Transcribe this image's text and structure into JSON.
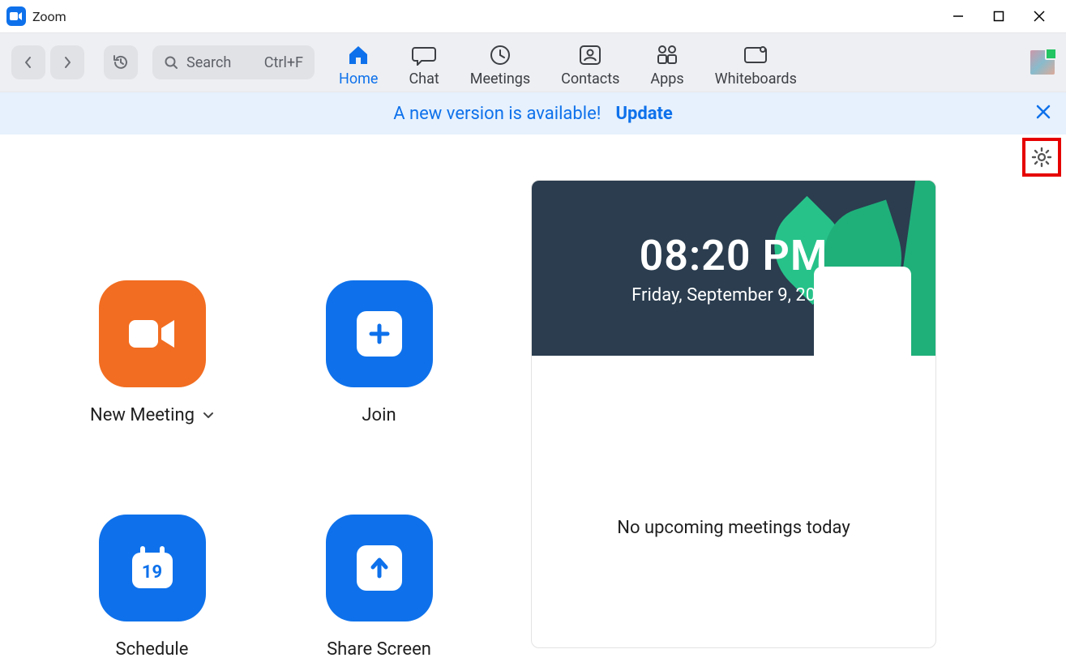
{
  "window": {
    "title": "Zoom"
  },
  "toolbar": {
    "search_placeholder": "Search",
    "search_shortcut": "Ctrl+F",
    "tabs": [
      {
        "label": "Home",
        "active": true
      },
      {
        "label": "Chat"
      },
      {
        "label": "Meetings"
      },
      {
        "label": "Contacts"
      },
      {
        "label": "Apps"
      },
      {
        "label": "Whiteboards"
      }
    ]
  },
  "banner": {
    "message": "A new version is available!",
    "action": "Update"
  },
  "actions": {
    "new_meeting": "New Meeting",
    "join": "Join",
    "schedule": "Schedule",
    "schedule_day": "19",
    "share_screen": "Share Screen"
  },
  "clock": {
    "time": "08:20 PM",
    "date": "Friday, September 9, 2022"
  },
  "upcoming": {
    "empty_text": "No upcoming meetings today"
  }
}
